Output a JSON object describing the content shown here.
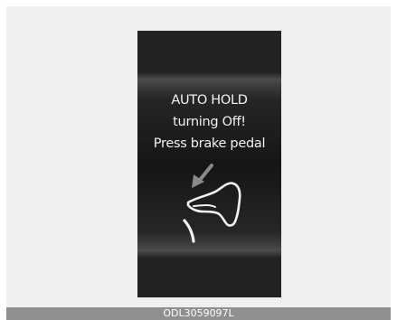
{
  "display": {
    "message_lines": [
      "AUTO HOLD",
      "turning Off!",
      "Press brake pedal"
    ],
    "icon": "brake-pedal-icon",
    "arrow_icon": "press-arrow-icon"
  },
  "caption": {
    "code": "ODL3059097L"
  },
  "colors": {
    "frame_bg": "#efefef",
    "display_bg": "#232323",
    "text": "#f2f2f2",
    "arrow": "#8a8a8a",
    "caption_bg": "#8f8f8f"
  }
}
